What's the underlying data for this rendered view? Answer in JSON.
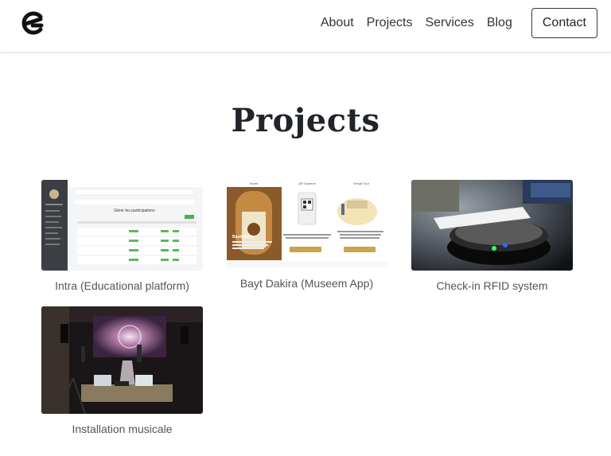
{
  "nav": {
    "links": [
      "About",
      "Projects",
      "Services",
      "Blog"
    ],
    "contact_label": "Contact"
  },
  "section": {
    "title": "Projects"
  },
  "projects": [
    {
      "title": "Intra (Educational platform)",
      "thumb_text": "Gérer les participations"
    },
    {
      "title": "Bayt Dakira (Museem App)",
      "thumb_labels": [
        "Home",
        "QR Scanner",
        "Virtual Tour"
      ],
      "thumb_brand": "BaytDakira"
    },
    {
      "title": "Check-in RFID system"
    },
    {
      "title": "Installation musicale"
    }
  ],
  "colors": {
    "text": "#212529",
    "caption": "#555555",
    "border": "#343a40"
  }
}
